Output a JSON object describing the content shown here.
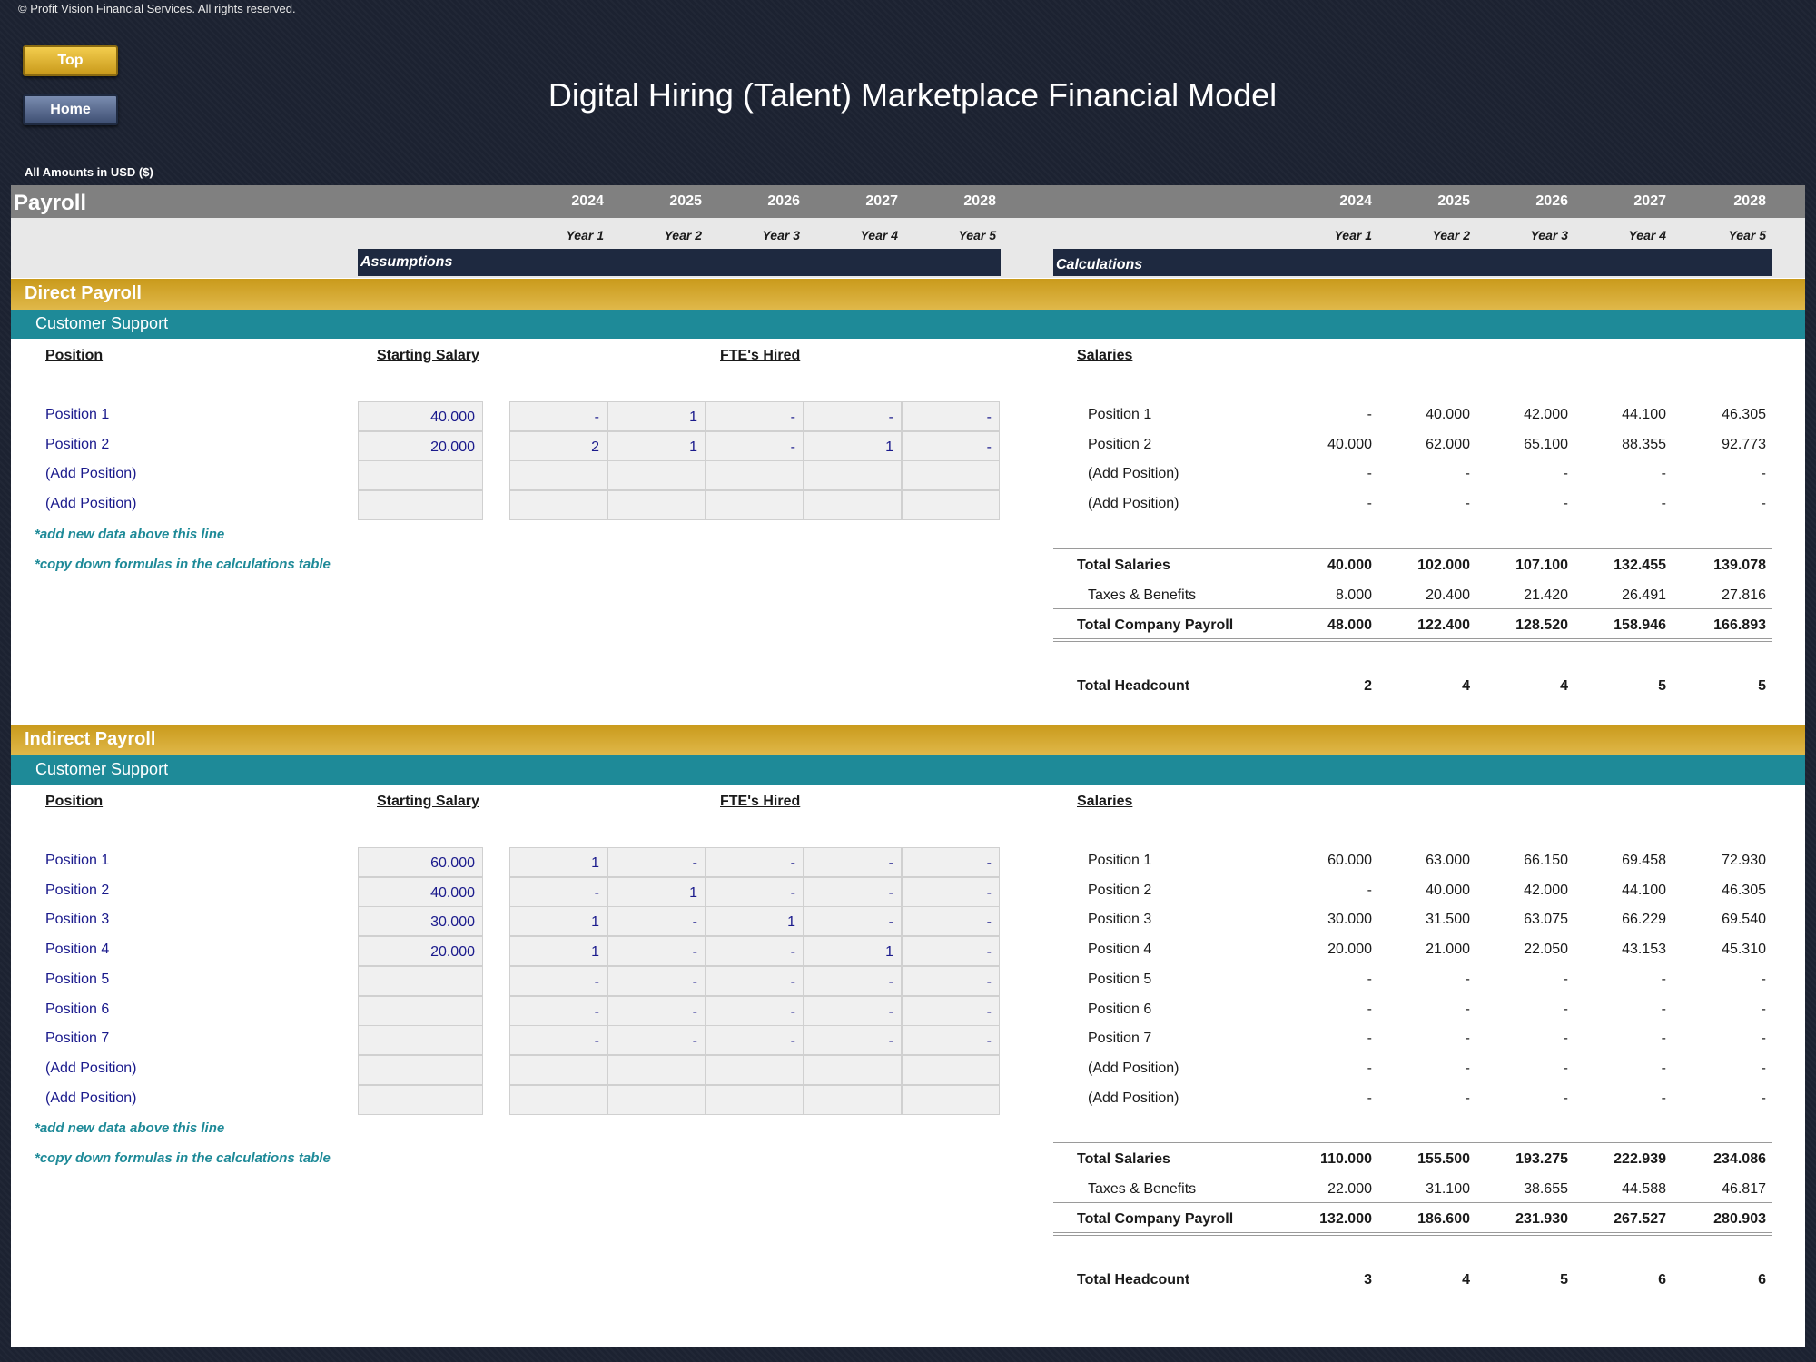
{
  "copyright": "© Profit Vision Financial Services. All rights reserved.",
  "buttons": {
    "top": "Top",
    "home": "Home"
  },
  "title": "Digital Hiring (Talent) Marketplace Financial Model",
  "units": "All Amounts in  USD ($)",
  "sheet": {
    "label": "Payroll",
    "years": [
      "2024",
      "2025",
      "2026",
      "2027",
      "2028"
    ],
    "year_names": [
      "Year 1",
      "Year 2",
      "Year 3",
      "Year 4",
      "Year 5"
    ],
    "assumptions_label": "Assumptions",
    "calculations_label": "Calculations"
  },
  "col_heads": {
    "position": "Position",
    "salary": "Starting Salary",
    "fte": "FTE's Hired",
    "salaries": "Salaries"
  },
  "notes": {
    "add": "*add new data above this line",
    "copy": "*copy down formulas in the calculations table"
  },
  "totals_labels": {
    "total_salaries": "Total Salaries",
    "taxes": "Taxes & Benefits",
    "company": "Total Company Payroll",
    "headcount": "Total Headcount"
  },
  "direct": {
    "title": "Direct Payroll",
    "dept": "Customer Support",
    "rows": [
      {
        "name": "Position 1",
        "salary": "40.000",
        "fte": [
          "-",
          "1",
          "-",
          "-",
          "-"
        ],
        "calc": [
          "-",
          "40.000",
          "42.000",
          "44.100",
          "46.305"
        ]
      },
      {
        "name": "Position 2",
        "salary": "20.000",
        "fte": [
          "2",
          "1",
          "-",
          "1",
          "-"
        ],
        "calc": [
          "40.000",
          "62.000",
          "65.100",
          "88.355",
          "92.773"
        ]
      },
      {
        "name": "(Add Position)",
        "salary": "",
        "fte": [
          "",
          "",
          "",
          "",
          ""
        ],
        "calc": [
          "-",
          "-",
          "-",
          "-",
          "-"
        ]
      },
      {
        "name": "(Add Position)",
        "salary": "",
        "fte": [
          "",
          "",
          "",
          "",
          ""
        ],
        "calc": [
          "-",
          "-",
          "-",
          "-",
          "-"
        ]
      }
    ],
    "total_salaries": [
      "40.000",
      "102.000",
      "107.100",
      "132.455",
      "139.078"
    ],
    "taxes": [
      "8.000",
      "20.400",
      "21.420",
      "26.491",
      "27.816"
    ],
    "company": [
      "48.000",
      "122.400",
      "128.520",
      "158.946",
      "166.893"
    ],
    "headcount": [
      "2",
      "4",
      "4",
      "5",
      "5"
    ]
  },
  "indirect": {
    "title": "Indirect Payroll",
    "dept": "Customer Support",
    "rows": [
      {
        "name": "Position 1",
        "salary": "60.000",
        "fte": [
          "1",
          "-",
          "-",
          "-",
          "-"
        ],
        "calc": [
          "60.000",
          "63.000",
          "66.150",
          "69.458",
          "72.930"
        ]
      },
      {
        "name": "Position 2",
        "salary": "40.000",
        "fte": [
          "-",
          "1",
          "-",
          "-",
          "-"
        ],
        "calc": [
          "-",
          "40.000",
          "42.000",
          "44.100",
          "46.305"
        ]
      },
      {
        "name": "Position 3",
        "salary": "30.000",
        "fte": [
          "1",
          "-",
          "1",
          "-",
          "-"
        ],
        "calc": [
          "30.000",
          "31.500",
          "63.075",
          "66.229",
          "69.540"
        ]
      },
      {
        "name": "Position 4",
        "salary": "20.000",
        "fte": [
          "1",
          "-",
          "-",
          "1",
          "-"
        ],
        "calc": [
          "20.000",
          "21.000",
          "22.050",
          "43.153",
          "45.310"
        ]
      },
      {
        "name": "Position 5",
        "salary": "",
        "fte": [
          "-",
          "-",
          "-",
          "-",
          "-"
        ],
        "calc": [
          "-",
          "-",
          "-",
          "-",
          "-"
        ]
      },
      {
        "name": "Position 6",
        "salary": "",
        "fte": [
          "-",
          "-",
          "-",
          "-",
          "-"
        ],
        "calc": [
          "-",
          "-",
          "-",
          "-",
          "-"
        ]
      },
      {
        "name": "Position 7",
        "salary": "",
        "fte": [
          "-",
          "-",
          "-",
          "-",
          "-"
        ],
        "calc": [
          "-",
          "-",
          "-",
          "-",
          "-"
        ]
      },
      {
        "name": "(Add Position)",
        "salary": "",
        "fte": [
          "",
          "",
          "",
          "",
          ""
        ],
        "calc": [
          "-",
          "-",
          "-",
          "-",
          "-"
        ]
      },
      {
        "name": "(Add Position)",
        "salary": "",
        "fte": [
          "",
          "",
          "",
          "",
          ""
        ],
        "calc": [
          "-",
          "-",
          "-",
          "-",
          "-"
        ]
      }
    ],
    "total_salaries": [
      "110.000",
      "155.500",
      "193.275",
      "222.939",
      "234.086"
    ],
    "taxes": [
      "22.000",
      "31.100",
      "38.655",
      "44.588",
      "46.817"
    ],
    "company": [
      "132.000",
      "186.600",
      "231.930",
      "267.527",
      "280.903"
    ],
    "headcount": [
      "3",
      "4",
      "5",
      "6",
      "6"
    ]
  }
}
